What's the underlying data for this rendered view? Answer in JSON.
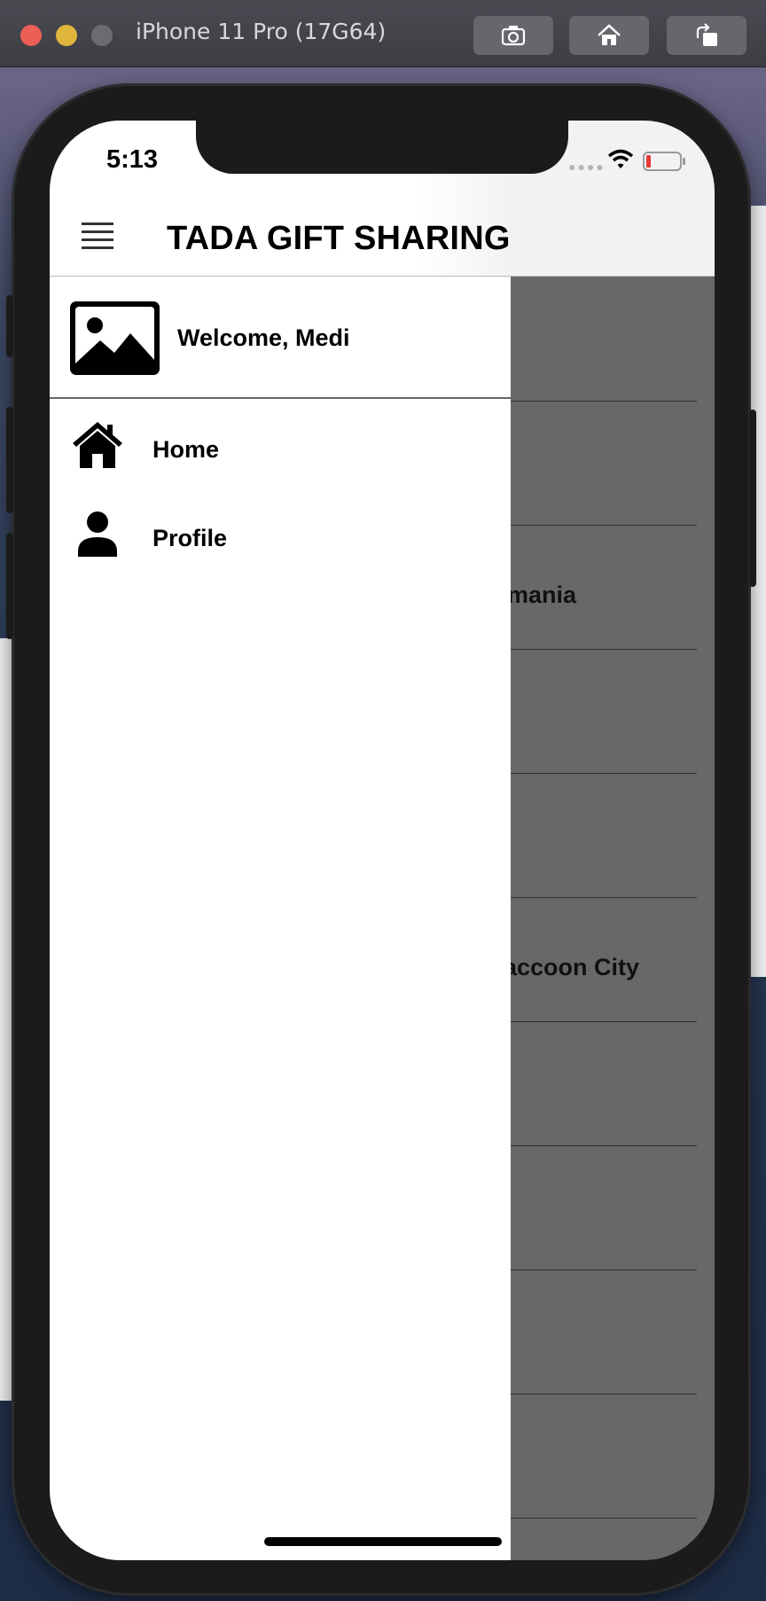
{
  "window": {
    "title": "iPhone 11 Pro (17G64)",
    "toolbar": [
      "screenshot-icon",
      "home-icon",
      "rotate-icon"
    ]
  },
  "status_bar": {
    "time": "5:13",
    "icons": [
      "signal-dots-icon",
      "wifi-icon",
      "battery-low-icon"
    ],
    "battery_color": "#e53935"
  },
  "app_bar": {
    "title": "TADA GIFT SHARING",
    "menu_icon": "hamburger-icon"
  },
  "drawer": {
    "welcome": "Welcome, Medi",
    "avatar_icon": "image-placeholder-icon",
    "items": [
      {
        "label": "Home",
        "icon": "home-icon"
      },
      {
        "label": "Profile",
        "icon": "person-icon"
      }
    ]
  },
  "background_list": {
    "visible_fragments": [
      "mania",
      "accoon City"
    ]
  },
  "colors": {
    "scrim": "#686868",
    "drawer_bg": "#ffffff",
    "header_bg": "#f2f2f2"
  }
}
